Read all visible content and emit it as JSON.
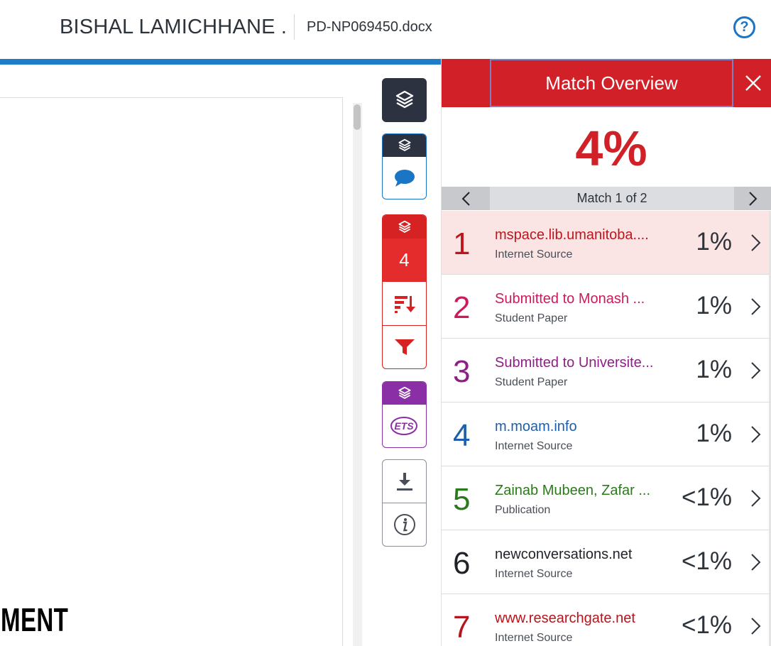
{
  "header": {
    "author": "BISHAL LAMICHHANE .",
    "filename": "PD-NP069450.docx",
    "help_label": "?"
  },
  "document": {
    "visible_text": "MENT"
  },
  "toolbar": {
    "similarity_count": "4",
    "icons": [
      "layers-icon",
      "comment-icon",
      "sort-icon",
      "filter-icon",
      "ets-icon",
      "download-icon",
      "info-icon"
    ],
    "ets_label": "ETS"
  },
  "panel": {
    "title": "Match Overview",
    "overall_percent": "4%",
    "nav_label": "Match 1 of 2",
    "accent_color": "#d12027",
    "matches": [
      {
        "num": "1",
        "name": "mspace.lib.umanitoba....",
        "type": "Internet Source",
        "percent": "1%",
        "color": "#c0141c",
        "active": true
      },
      {
        "num": "2",
        "name": "Submitted to Monash ...",
        "type": "Student Paper",
        "percent": "1%",
        "color": "#cc1a5c",
        "active": false
      },
      {
        "num": "3",
        "name": "Submitted to Universite...",
        "type": "Student Paper",
        "percent": "1%",
        "color": "#8d1f86",
        "active": false
      },
      {
        "num": "4",
        "name": "m.moam.info",
        "type": "Internet Source",
        "percent": "1%",
        "color": "#1f5ea8",
        "active": false
      },
      {
        "num": "5",
        "name": "Zainab Mubeen, Zafar ...",
        "type": "Publication",
        "percent": "<1%",
        "color": "#2b7a1a",
        "active": false
      },
      {
        "num": "6",
        "name": "newconversations.net",
        "type": "Internet Source",
        "percent": "<1%",
        "color": "#1f2328",
        "active": false
      },
      {
        "num": "7",
        "name": "www.researchgate.net",
        "type": "Internet Source",
        "percent": "<1%",
        "color": "#b8141c",
        "active": false
      }
    ]
  }
}
